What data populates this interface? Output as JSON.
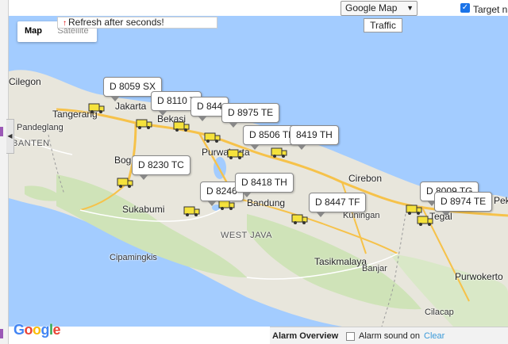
{
  "top_bar": {
    "map_type_select": "Google Map",
    "target_label": "Target na",
    "target_checked": true
  },
  "map": {
    "type_buttons": {
      "map": "Map",
      "satellite": "Satellite"
    },
    "refresh_text": "Refresh after seconds!",
    "traffic_button": "Traffic",
    "places": [
      {
        "name": "Jakarta"
      },
      {
        "name": "Tangerang"
      },
      {
        "name": "Bekasi"
      },
      {
        "name": "Purwakarta"
      },
      {
        "name": "Pandeglang"
      },
      {
        "name": "BANTEN"
      },
      {
        "name": "Bogor"
      },
      {
        "name": "Sukabumi"
      },
      {
        "name": "Bandung"
      },
      {
        "name": "WEST JAVA"
      },
      {
        "name": "Cirebon"
      },
      {
        "name": "Kuningan"
      },
      {
        "name": "Tasikmalaya"
      },
      {
        "name": "Banjar"
      },
      {
        "name": "Cipamingkis"
      },
      {
        "name": "Purwokerto"
      },
      {
        "name": "Cilacap"
      },
      {
        "name": "Tegal"
      },
      {
        "name": "Cilegon"
      },
      {
        "name": "Pek"
      }
    ],
    "vehicles": [
      "D 8059 SX",
      "D 8110 T",
      "D 844",
      "D 8975 TE",
      "D 8506 TF",
      "8419 TH",
      "D 8230 TC",
      "D 8246",
      "D 8418 TH",
      "D 8447 TF",
      "D 8009 TG",
      "D 8974 TE"
    ],
    "google_logo": [
      "G",
      "o",
      "o",
      "g",
      "l",
      "e"
    ],
    "colors": {
      "water": "#a3ccff",
      "land": "#e8e6dc",
      "highway": "#f6c24a",
      "forest": "#cfe3b8",
      "truck": "#f5e23c"
    }
  },
  "alarm": {
    "title": "Alarm Overview",
    "sound_label": "Alarm sound on",
    "clear_link": "Clear"
  }
}
